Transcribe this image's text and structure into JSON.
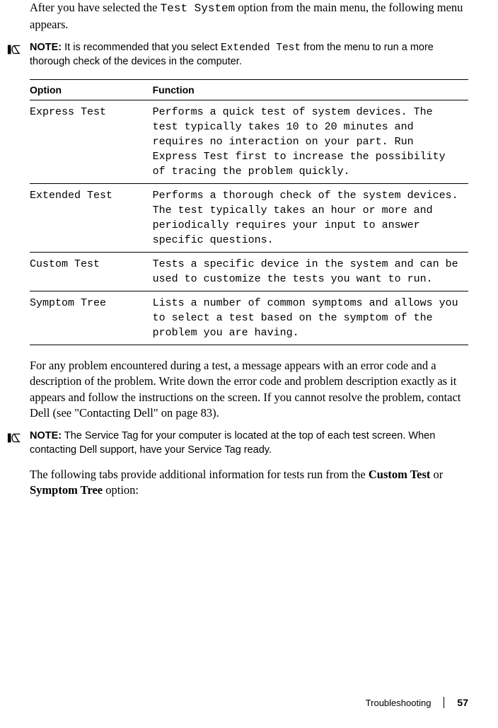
{
  "intro": {
    "pre": "After you have selected the ",
    "code": "Test System",
    "post": " option from the main menu, the following menu appears."
  },
  "note1": {
    "label": "NOTE:",
    "pre": " It is recommended that you select ",
    "code": "Extended Test",
    "post": " from the menu to run a more thorough check of the devices in the computer."
  },
  "table": {
    "headers": {
      "option": "Option",
      "function": "Function"
    },
    "rows": [
      {
        "option": "Express Test",
        "function": "Performs a quick test of system devices. The test typically takes 10 to 20 minutes and requires no interaction on your part. Run Express Test first to increase the possibility of tracing the problem quickly."
      },
      {
        "option": "Extended Test",
        "function": "Performs a thorough check of the system devices. The test typically takes an hour or more and periodically requires your input to answer specific questions."
      },
      {
        "option": "Custom Test",
        "function": "Tests a specific device in the system and can be used to customize the tests you want to run."
      },
      {
        "option": "Symptom Tree",
        "function": "Lists a number of common symptoms and allows you to select a test based on the symptom of the problem you are having."
      }
    ]
  },
  "para2": "For any problem encountered during a test, a message appears with an error code and a description of the problem. Write down the error code and problem description exactly as it appears and follow the instructions on the screen. If you cannot resolve the problem, contact Dell (see \"Contacting Dell\" on page 83).",
  "note2": {
    "label": "NOTE:",
    "text": " The Service Tag for your computer is located at the top of each test screen. When contacting Dell support, have your Service Tag ready."
  },
  "para3": {
    "pre": "The following tabs provide additional information for tests run from the ",
    "b1": "Custom Test",
    "mid": " or ",
    "b2": "Symptom Tree",
    "post": " option:"
  },
  "footer": {
    "section": "Troubleshooting",
    "page": "57"
  }
}
